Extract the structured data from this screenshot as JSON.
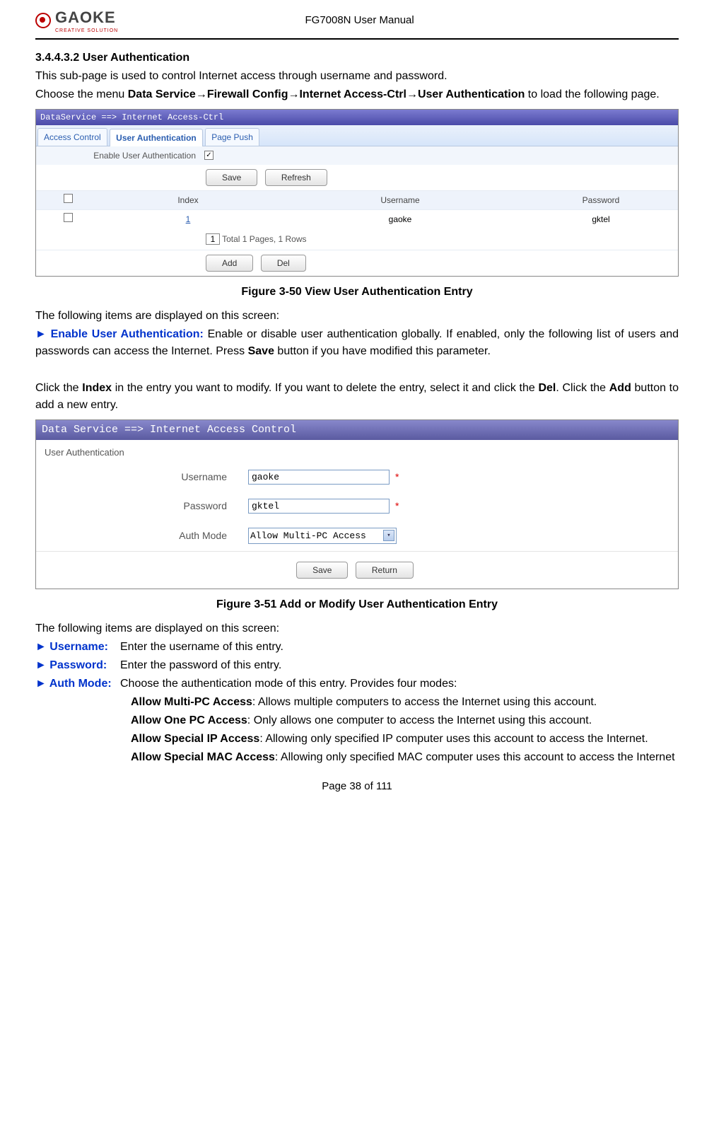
{
  "header": {
    "logo_text": "GAOKE",
    "logo_sub": "CREATIVE SOLUTION",
    "doc_title": "FG7008N User Manual"
  },
  "section": {
    "num": "3.4.4.3.2",
    "title": "User Authentication",
    "intro": "This sub-page is used to control Internet access through username and password.",
    "menu_pre": "Choose the menu ",
    "menu_path": "Data Service→Firewall Config→Internet Access-Ctrl→User Authentication",
    "menu_post": " to load the following page."
  },
  "ss1": {
    "titlebar": "DataService ==> Internet Access-Ctrl",
    "tabs": {
      "t1": "Access Control",
      "t2": "User Authentication",
      "t3": "Page Push"
    },
    "enable_label": "Enable User Authentication",
    "enable_checked": "✓",
    "btn_save": "Save",
    "btn_refresh": "Refresh",
    "cols": {
      "chk": "",
      "idx": "Index",
      "usr": "Username",
      "pwd": "Password"
    },
    "row1": {
      "idx": "1",
      "usr": "gaoke",
      "pwd": "gktel"
    },
    "pager_val": "1",
    "pager_text": " Total 1 Pages, 1 Rows",
    "btn_add": "Add",
    "btn_del": "Del"
  },
  "fig1": "Figure 3-50   View User Authentication Entry",
  "after_fig1": {
    "line1": "The following items are displayed on this screen:",
    "enable_term": "► Enable User Authentication:",
    "enable_desc": "   Enable or disable user authentication globally. If enabled, only the following list of users and passwords can access the Internet. Press ",
    "save_bold": "Save",
    "enable_desc2": " button if you have modified this parameter.",
    "click_idx_pre": "Click the ",
    "index_bold": "Index",
    "click_idx_mid": " in the entry you want to modify. If you want to delete the entry, select it and click the ",
    "del_bold": "Del",
    "click_idx_end": ". Click the ",
    "add_bold": "Add",
    "click_idx_end2": " button to add a new entry."
  },
  "ss2": {
    "titlebar": "Data Service ==> Internet Access Control",
    "subtitle": "User Authentication",
    "username_lbl": "Username",
    "username_val": "gaoke",
    "password_lbl": "Password",
    "password_val": "gktel",
    "authmode_lbl": "Auth Mode",
    "authmode_val": "Allow Multi-PC Access",
    "req": "*",
    "btn_save": "Save",
    "btn_return": "Return"
  },
  "fig2": "Figure 3-51   Add or Modify User Authentication Entry",
  "after_fig2": {
    "line1": "The following items are displayed on this screen:",
    "username_term": "► Username:",
    "username_desc": "Enter the username of this entry.",
    "password_term": "► Password:",
    "password_desc": "Enter the password of this entry.",
    "authmode_term": "► Auth Mode:",
    "authmode_desc": "Choose the authentication mode of this entry. Provides four modes:",
    "m1_b": "Allow Multi-PC Access",
    "m1_t": ": Allows multiple computers to access the Internet using this account.",
    "m2_b": "Allow One PC Access",
    "m2_t": ":   Only allows one computer to access the Internet using this account.",
    "m3_b": "Allow Special IP Access",
    "m3_t": ": Allowing only specified IP computer uses this account to access the Internet.",
    "m4_b": "Allow Special MAC Access",
    "m4_t": ": Allowing only specified MAC computer uses this account to access the Internet"
  },
  "footer": "Page 38 of 111"
}
